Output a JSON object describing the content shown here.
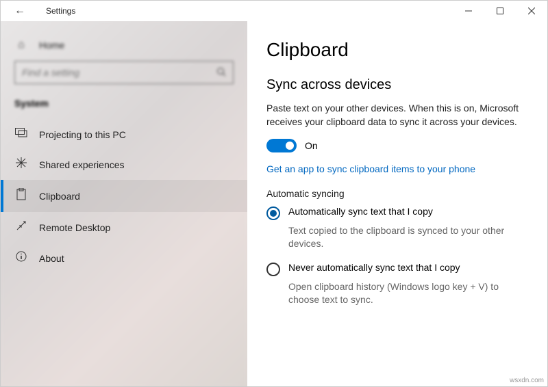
{
  "titlebar": {
    "title": "Settings"
  },
  "sidebar": {
    "home_label": "Home",
    "search_placeholder": "Find a setting",
    "category": "System",
    "items": [
      {
        "label": "Projecting to this PC"
      },
      {
        "label": "Shared experiences"
      },
      {
        "label": "Clipboard"
      },
      {
        "label": "Remote Desktop"
      },
      {
        "label": "About"
      }
    ]
  },
  "page": {
    "title": "Clipboard",
    "section_title": "Sync across devices",
    "description": "Paste text on your other devices. When this is on, Microsoft receives your clipboard data to sync it across your devices.",
    "toggle_state": "On",
    "link_text": "Get an app to sync clipboard items to your phone",
    "sub_title": "Automatic syncing",
    "options": [
      {
        "label": "Automatically sync text that I copy",
        "desc": "Text copied to the clipboard is synced to your other devices.",
        "selected": true
      },
      {
        "label": "Never automatically sync text that I copy",
        "desc": "Open clipboard history (Windows logo key + V) to choose text to sync.",
        "selected": false
      }
    ]
  },
  "watermark": "wsxdn.com"
}
